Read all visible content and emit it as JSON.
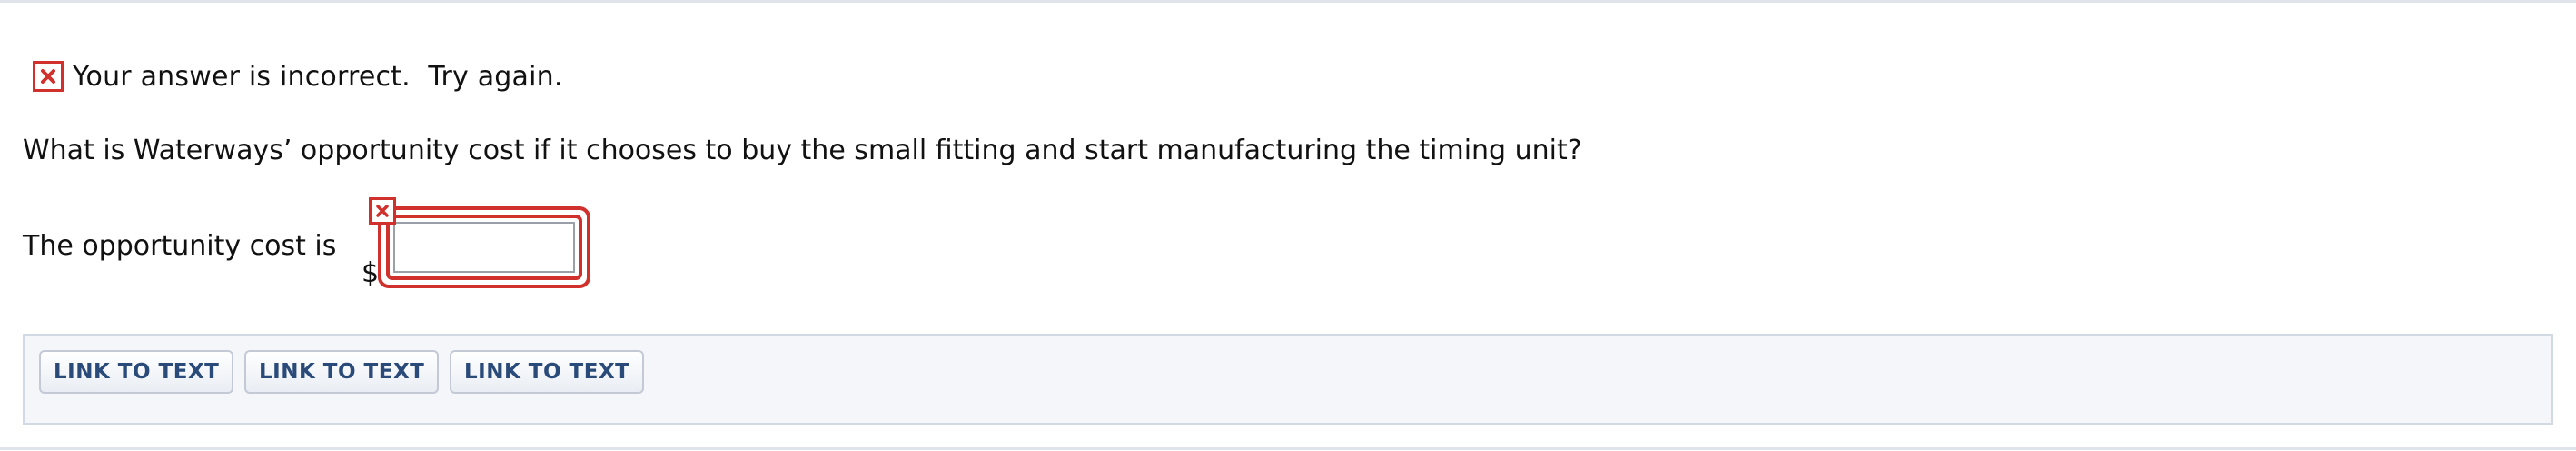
{
  "feedback": {
    "icon": "incorrect-x-icon",
    "message": "Your answer is incorrect.  Try again."
  },
  "question": {
    "text": "What is Waterways’ opportunity cost if it chooses to buy the small fitting and start manufacturing the timing unit?"
  },
  "answer": {
    "label": "The opportunity cost is",
    "currency_symbol": "$",
    "value": "",
    "status": "incorrect",
    "status_icon": "incorrect-x-icon"
  },
  "links": {
    "items": [
      {
        "label": "LINK TO TEXT"
      },
      {
        "label": "LINK TO TEXT"
      },
      {
        "label": "LINK TO TEXT"
      }
    ]
  },
  "colors": {
    "error_red": "#d0312d",
    "link_text": "#2a4a7a",
    "link_bar_bg": "#f4f6f9"
  }
}
